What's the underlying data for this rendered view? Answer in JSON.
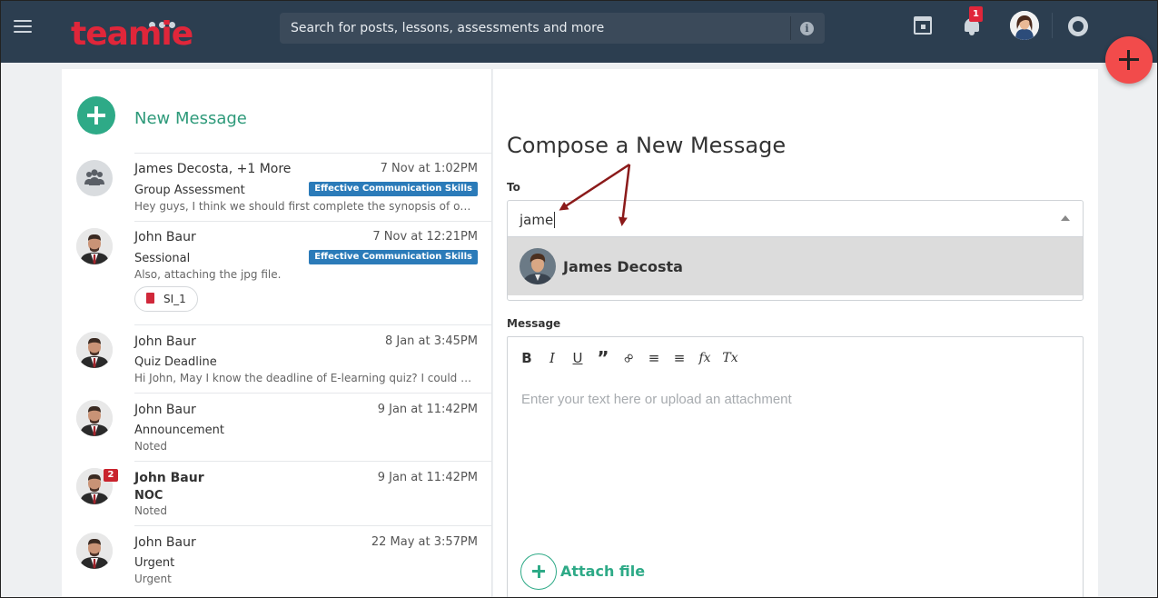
{
  "header": {
    "logo_text": "teamie",
    "search_placeholder": "Search for posts, lessons, assessments and more",
    "notification_count": "1",
    "icons": [
      "menu-icon",
      "info-icon",
      "calendar-icon",
      "bell-icon",
      "help-icon",
      "add-icon"
    ]
  },
  "sidebar": {
    "new_message_label": "New Message",
    "threads": [
      {
        "name": "James Decosta, +1 More",
        "date": "7 Nov at 1:02PM",
        "subject": "Group Assessment",
        "tag": "Effective Communication Skills",
        "preview": "Hey guys, I think we should first complete the synopsis of our project",
        "avatar": "group-icon"
      },
      {
        "name": "John Baur",
        "date": "7 Nov at 12:21PM",
        "subject": "Sessional",
        "tag": "Effective Communication Skills",
        "preview": "Also, attaching the jpg file.",
        "attachment": "SI_1"
      },
      {
        "name": "John Baur",
        "date": "8 Jan at 3:45PM",
        "subject": "Quiz Deadline",
        "preview": "Hi John, May I know the deadline of E-learning quiz? I could not find it"
      },
      {
        "name": "John Baur",
        "date": "9 Jan at 11:42PM",
        "subject": "Announcement",
        "preview": "Noted"
      },
      {
        "name": "John Baur",
        "date": "9 Jan at 11:42PM",
        "subject": "NOC",
        "preview": "Noted",
        "unread_count": "2"
      },
      {
        "name": "John Baur",
        "date": "22 May at 3:57PM",
        "subject": "Urgent",
        "preview": "Urgent"
      }
    ]
  },
  "compose": {
    "title": "Compose a New Message",
    "to_label": "To",
    "to_value": "jame",
    "suggestion_name": "James Decosta",
    "message_label": "Message",
    "message_placeholder": "Enter your text here or upload an attachment",
    "attach_label": "Attach file",
    "toolbar": {
      "bold": "B",
      "italic": "I",
      "underline": "U",
      "quote": "”",
      "link": "∞",
      "numbered": "≡",
      "bulleted": "≡",
      "formula": "fx",
      "clear": "Tx"
    }
  },
  "colors": {
    "topbar": "#2c3e50",
    "brand_red": "#e0263a",
    "accent_green": "#2eaa87",
    "tag_blue": "#2b7bb9",
    "fab": "#f24b4b",
    "annotation": "#8b1a1a"
  }
}
